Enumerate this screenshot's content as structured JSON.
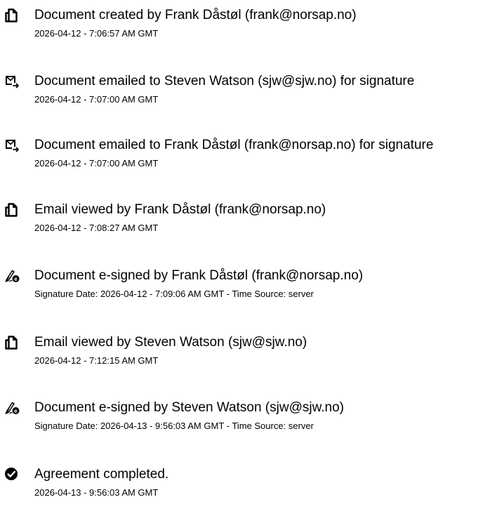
{
  "events": [
    {
      "icon": "document-icon",
      "title": "Document created by Frank Dåstøl (frank@norsap.no)",
      "detail": "2026-04-12 - 7:06:57 AM GMT"
    },
    {
      "icon": "email-sent-icon",
      "title": "Document emailed to Steven Watson (sjw@sjw.no) for signature",
      "detail": "2026-04-12 - 7:07:00 AM GMT"
    },
    {
      "icon": "email-sent-icon",
      "title": "Document emailed to Frank Dåstøl (frank@norsap.no) for signature",
      "detail": "2026-04-12 - 7:07:00 AM GMT"
    },
    {
      "icon": "document-icon",
      "title": "Email viewed by Frank Dåstøl (frank@norsap.no)",
      "detail": "2026-04-12 - 7:08:27 AM GMT"
    },
    {
      "icon": "esign-icon",
      "title": "Document e-signed by Frank Dåstøl (frank@norsap.no)",
      "detail": "Signature Date: 2026-04-12 - 7:09:06 AM GMT - Time Source: server"
    },
    {
      "icon": "document-icon",
      "title": "Email viewed by Steven Watson (sjw@sjw.no)",
      "detail": "2026-04-12 - 7:12:15 AM GMT"
    },
    {
      "icon": "esign-icon",
      "title": "Document e-signed by Steven Watson (sjw@sjw.no)",
      "detail": "Signature Date: 2026-04-13 - 9:56:03 AM GMT - Time Source: server"
    },
    {
      "icon": "check-circle-icon",
      "title": "Agreement completed.",
      "detail": "2026-04-13 - 9:56:03 AM GMT"
    }
  ]
}
